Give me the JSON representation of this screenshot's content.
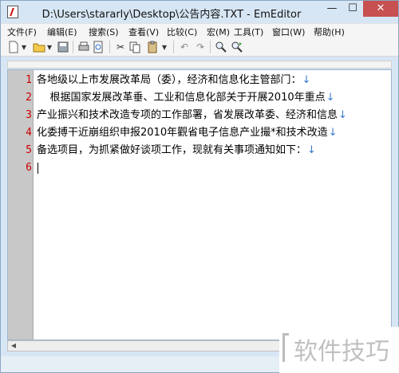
{
  "window": {
    "title": "D:\\Users\\stararly\\Desktop\\公告内容.TXT - EmEditor",
    "min_glyph": "—",
    "max_glyph": "☐",
    "close_glyph": "✕"
  },
  "menu": {
    "items": [
      {
        "label": "文件(F)"
      },
      {
        "label": "编辑(E)"
      },
      {
        "label": "搜索(S)"
      },
      {
        "label": "查看(V)"
      },
      {
        "label": "比较(C)"
      },
      {
        "label": "宏(M)"
      },
      {
        "label": "工具(T)"
      },
      {
        "label": "窗口(W)"
      },
      {
        "label": "帮助(H)"
      }
    ]
  },
  "toolbar": {
    "icons": [
      "new-file-icon",
      "dropdown-icon",
      "open-folder-icon",
      "dropdown-icon",
      "save-icon",
      "print-icon",
      "print-preview-icon",
      "cut-icon",
      "copy-icon",
      "paste-icon",
      "dropdown-icon",
      "undo-icon",
      "redo-icon",
      "find-icon",
      "find-next-icon"
    ]
  },
  "editor": {
    "eol_mark": "↓",
    "lines": [
      {
        "num": "1",
        "text": "各地级以上市发展改革局（委），经济和信息化主管部门："
      },
      {
        "num": "2",
        "text": "    根据国家发展改革垂、工业和信息化部关于开展2010年重点"
      },
      {
        "num": "3",
        "text": "产业振兴和技术改造专项的工作部署，省发展改革委、经济和信息"
      },
      {
        "num": "4",
        "text": "化委搏干近崩组织申报2010年觀省电子信息产业撮*和技术改造"
      },
      {
        "num": "5",
        "text": "备选项目，为抓紧做好谈项工作，现就有关事项通知如下："
      },
      {
        "num": "6",
        "text": ""
      }
    ]
  },
  "watermark": {
    "text": "软件技巧"
  },
  "colors": {
    "line_number": "#cc0000",
    "eol_mark": "#3a7ad0",
    "gutter": "#c8c8c8",
    "titlebar": "#d7e6f4",
    "close_button": "#c75050"
  }
}
